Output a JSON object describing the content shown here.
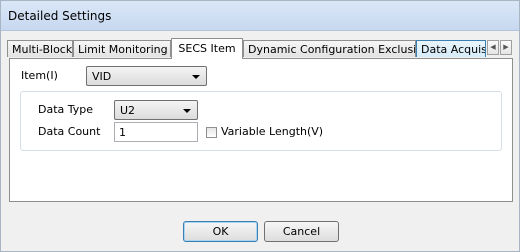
{
  "window": {
    "title": "Detailed Settings"
  },
  "tabs": [
    {
      "label": "Multi-Block"
    },
    {
      "label": "Limit Monitoring"
    },
    {
      "label": "SECS Item"
    },
    {
      "label": "Dynamic Configuration Exclusion"
    },
    {
      "label": "Data Acquisi"
    }
  ],
  "tab_scroll": {
    "left_glyph": "◀",
    "right_glyph": "▶"
  },
  "item": {
    "label": "Item(I)",
    "value": "VID"
  },
  "data_type": {
    "label": "Data Type",
    "value": "U2"
  },
  "data_count": {
    "label": "Data Count",
    "value": "1"
  },
  "variable_length": {
    "label": "Variable Length(V)",
    "checked": false
  },
  "buttons": {
    "ok": "OK",
    "cancel": "Cancel"
  }
}
